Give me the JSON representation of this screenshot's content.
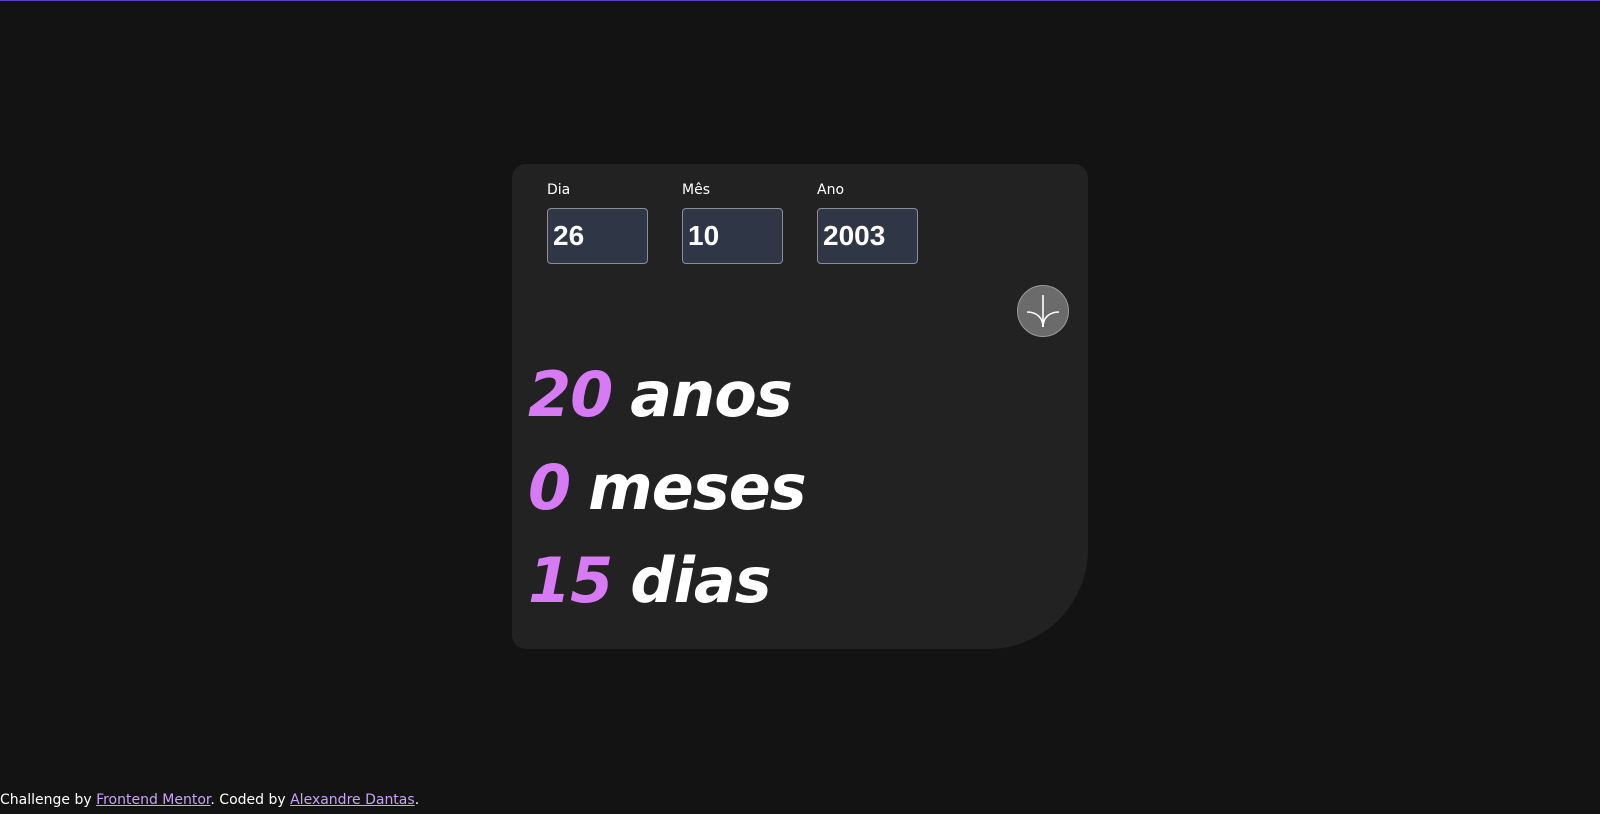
{
  "form": {
    "day": {
      "label": "Dia",
      "value": "26"
    },
    "month": {
      "label": "Mês",
      "value": "10"
    },
    "year": {
      "label": "Ano",
      "value": "2003"
    },
    "submit_icon": "arrow-down-icon"
  },
  "result": {
    "years": {
      "value": "20",
      "unit": "anos"
    },
    "months": {
      "value": "0",
      "unit": "meses"
    },
    "days": {
      "value": "15",
      "unit": "dias"
    }
  },
  "footer": {
    "prefix": "Challenge by",
    "link1": "Frontend Mentor",
    "middle": ". Coded by",
    "link2": "Alexandre Dantas",
    "suffix": "."
  },
  "colors": {
    "background": "#131313",
    "card": "#222222",
    "accent": "#d67bf3",
    "input_bg": "#2f3746",
    "link": "#c9a3f7"
  }
}
